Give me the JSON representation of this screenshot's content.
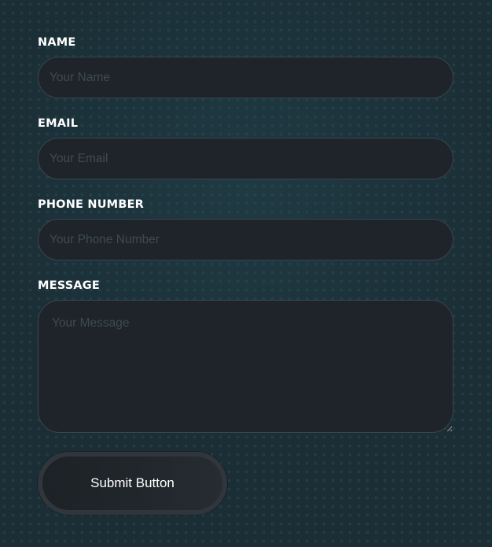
{
  "form": {
    "name": {
      "label": "NAME",
      "placeholder": "Your Name"
    },
    "email": {
      "label": "EMAIL",
      "placeholder": "Your Email"
    },
    "phone": {
      "label": "PHONE NUMBER",
      "placeholder": "Your Phone Number"
    },
    "message": {
      "label": "MESSAGE",
      "placeholder": "Your Message"
    },
    "submit_label": "Submit Button"
  },
  "colors": {
    "background": "#1b2e36",
    "field_background": "#1f242a",
    "field_border": "#3a454c",
    "label_text": "#ffffff",
    "placeholder_text": "#3e4a53"
  }
}
